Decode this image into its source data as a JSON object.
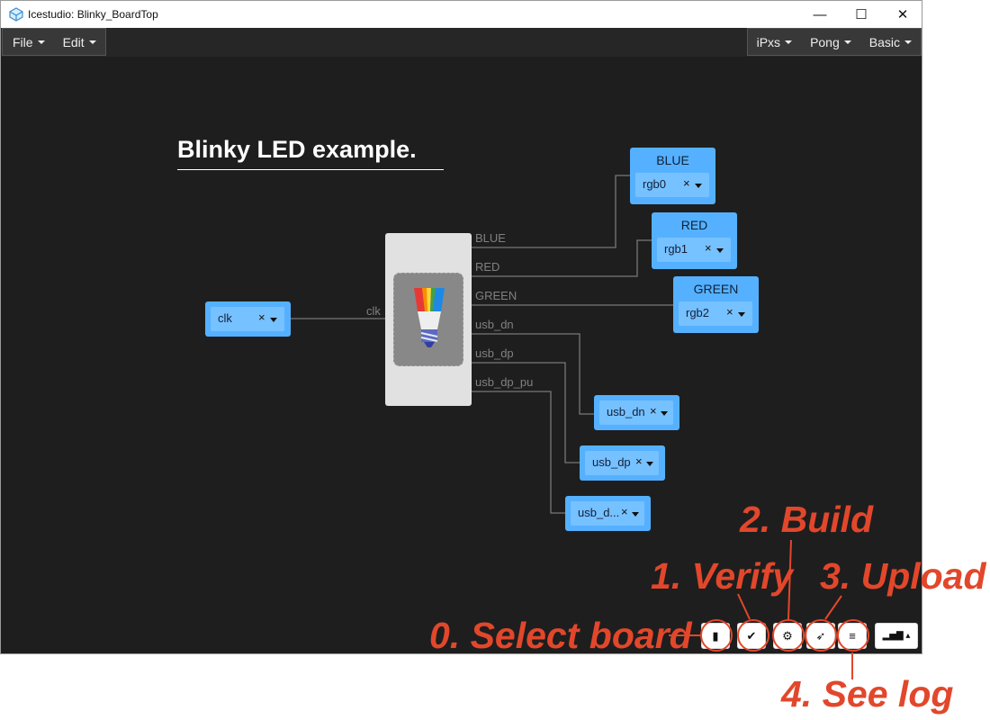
{
  "window": {
    "title": "Icestudio: Blinky_BoardTop"
  },
  "menu_left": [
    "File",
    "Edit"
  ],
  "menu_right": [
    "iPxs",
    "Pong",
    "Basic"
  ],
  "canvas": {
    "heading": "Blinky LED example.",
    "input_port": {
      "value": "clk",
      "wire_label": "clk"
    },
    "module_icon": "rgb-led-bulb-icon",
    "module_ports": [
      "BLUE",
      "RED",
      "GREEN",
      "usb_dn",
      "usb_dp",
      "usb_dp_pu"
    ],
    "outputs": [
      {
        "name": "BLUE",
        "value": "rgb0"
      },
      {
        "name": "RED",
        "value": "rgb1"
      },
      {
        "name": "GREEN",
        "value": "rgb2"
      },
      {
        "name": "",
        "value": "usb_dn"
      },
      {
        "name": "",
        "value": "usb_dp"
      },
      {
        "name": "",
        "value": "usb_d..."
      }
    ],
    "clear_glyph": "×"
  },
  "toolbar": [
    {
      "name": "select-board-button",
      "icon": "chip-icon",
      "glyph": "▮"
    },
    {
      "name": "verify-button",
      "icon": "check-icon",
      "glyph": "✔"
    },
    {
      "name": "build-button",
      "icon": "gear-icon",
      "glyph": "⚙"
    },
    {
      "name": "upload-button",
      "icon": "rocket-icon",
      "glyph": "➶"
    },
    {
      "name": "log-button",
      "icon": "log-lines-icon",
      "glyph": "≡"
    },
    {
      "name": "stats-button",
      "icon": "bar-chart-icon",
      "glyph": "▂▅▇ ▴"
    }
  ],
  "annotations": [
    "0. Select board",
    "1. Verify",
    "2. Build",
    "3. Upload",
    "4. See log"
  ],
  "colors": {
    "canvas_bg": "#1e1e1e",
    "port_block": "#55b1ff",
    "port_select": "#76c1ff",
    "wire": "#777777",
    "annotation": "#e2472b"
  }
}
